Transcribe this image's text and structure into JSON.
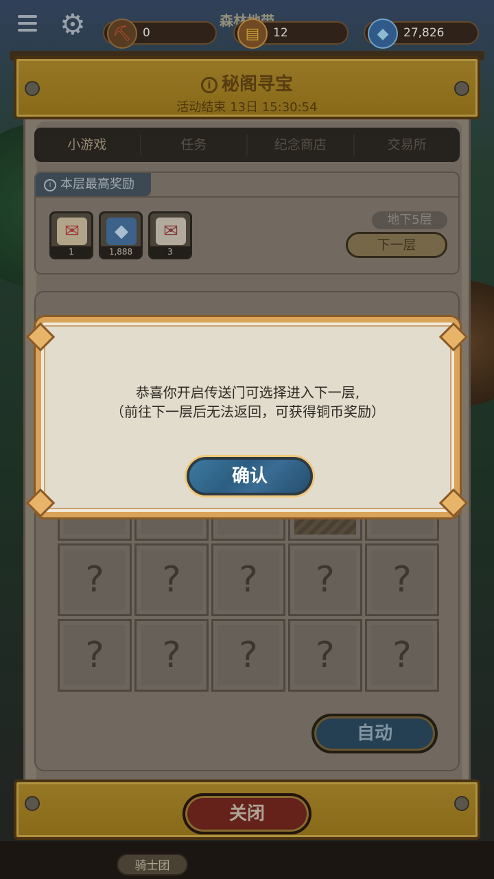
{
  "top_bar": {
    "map_title": "森林地带",
    "currencies": [
      {
        "icon": "shovel-icon",
        "value": "0"
      },
      {
        "icon": "ticket-icon",
        "value": "12"
      },
      {
        "icon": "gem-icon",
        "value": "27,826"
      }
    ]
  },
  "header": {
    "title": "秘阁寻宝",
    "subtitle": "活动结束 13日 15:30:54"
  },
  "tabs": [
    {
      "label": "小游戏",
      "active": true
    },
    {
      "label": "任务",
      "active": false
    },
    {
      "label": "纪念商店",
      "active": false
    },
    {
      "label": "交易所",
      "active": false
    }
  ],
  "reward": {
    "tag": "本层最高奖励",
    "items": [
      {
        "icon": "voucher-icon",
        "count": "1"
      },
      {
        "icon": "gem-pile-icon",
        "count": "1,888"
      },
      {
        "icon": "voucher-icon",
        "count": "3"
      }
    ],
    "floor": "地下5层",
    "next_floor_label": "下一层"
  },
  "grid": {
    "cell_symbol": "?",
    "auto_label": "自动"
  },
  "dialog": {
    "line1": "恭喜你开启传送门可选择进入下一层,",
    "line2": "（前往下一层后无法返回，可获得铜币奖励）",
    "confirm_label": "确认"
  },
  "footer": {
    "close_label": "关闭",
    "knight_tab": "骑士团"
  },
  "colors": {
    "gold_frame": "#b8922e",
    "dialog_bg": "#e2dccc",
    "confirm_blue": "#2c5e82",
    "close_red": "#7a2a22"
  }
}
